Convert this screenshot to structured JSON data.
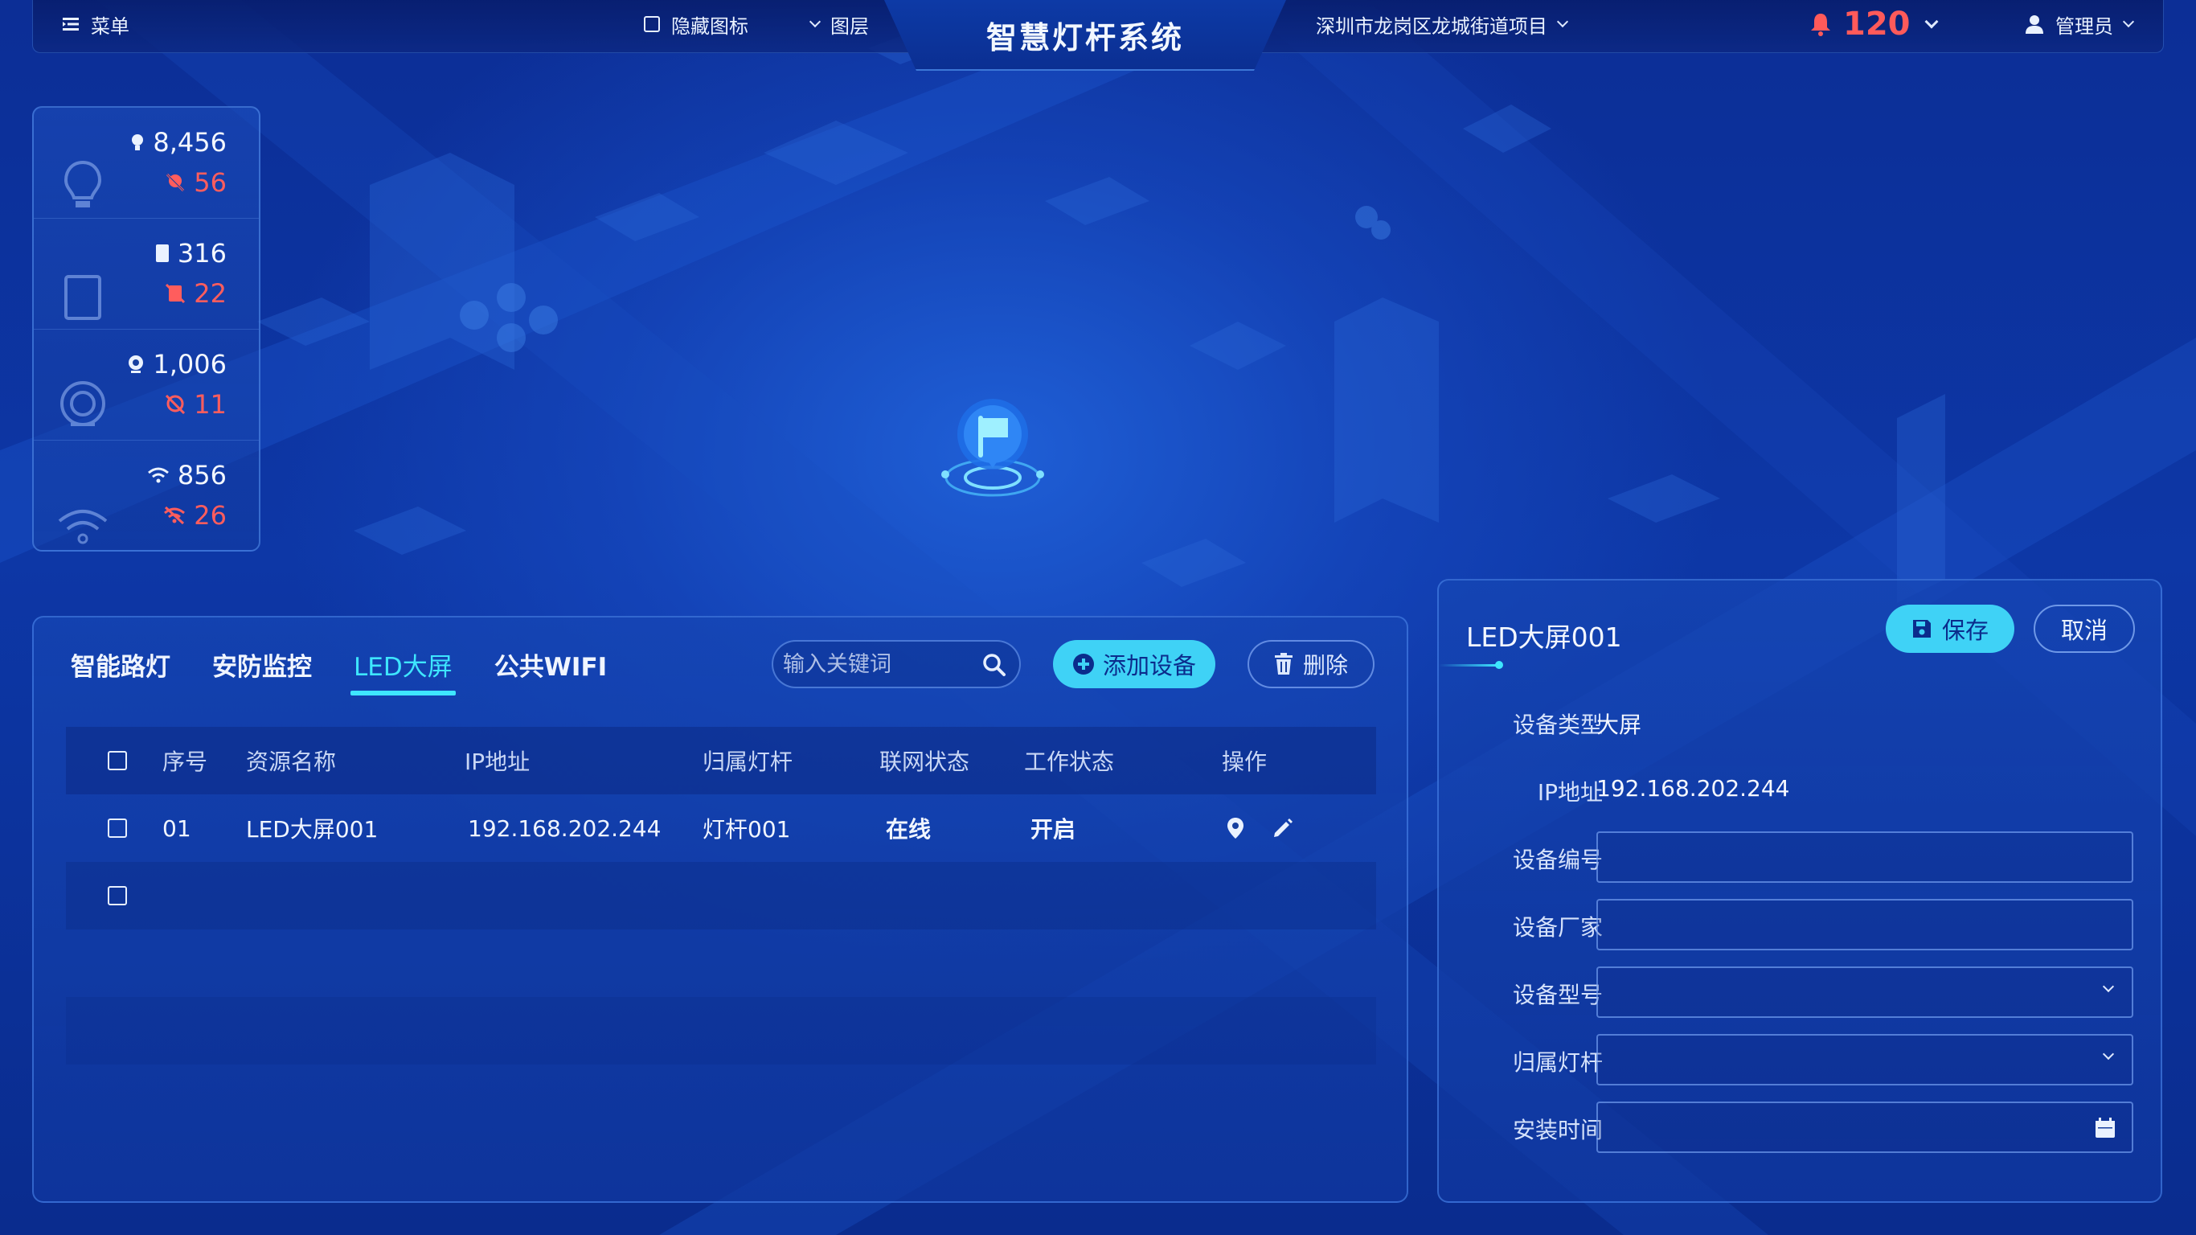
{
  "header": {
    "menu_label": "菜单",
    "hide_icons_label": "隐藏图标",
    "layers_label": "图层",
    "title": "智慧灯杆系统",
    "project": "深圳市龙岗区龙城街道项目",
    "alarm_count": "120",
    "user": "管理员"
  },
  "stats": [
    {
      "icon": "streetlight-icon",
      "total": "8,456",
      "fault": "56"
    },
    {
      "icon": "led-screen-icon",
      "total": "316",
      "fault": "22"
    },
    {
      "icon": "camera-icon",
      "total": "1,006",
      "fault": "11"
    },
    {
      "icon": "wifi-icon",
      "total": "856",
      "fault": "26"
    }
  ],
  "tabs": [
    "智能路灯",
    "安防监控",
    "LED大屏",
    "公共WIFI"
  ],
  "active_tab": "LED大屏",
  "search": {
    "placeholder": "输入关键词"
  },
  "actions": {
    "add": "添加设备",
    "delete": "删除"
  },
  "table": {
    "headers": [
      "序号",
      "资源名称",
      "IP地址",
      "归属灯杆",
      "联网状态",
      "工作状态",
      "操作"
    ],
    "rows": [
      {
        "index": "01",
        "name": "LED大屏001",
        "ip": "192.168.202.244",
        "pole": "灯杆001",
        "network": "在线",
        "work": "开启"
      }
    ]
  },
  "detail": {
    "title": "LED大屏001",
    "save": "保存",
    "cancel": "取消",
    "fields": {
      "type_label": "设备类型",
      "type_value": "大屏",
      "ip_label": "IP地址",
      "ip_value": "192.168.202.244",
      "code_label": "设备编号",
      "vendor_label": "设备厂家",
      "model_label": "设备型号",
      "pole_label": "归属灯杆",
      "install_label": "安装时间"
    }
  },
  "colors": {
    "accent": "#3ee6ff",
    "button": "#3fd2f6",
    "alert": "#ff5a5a",
    "background": "#0c2e96"
  }
}
